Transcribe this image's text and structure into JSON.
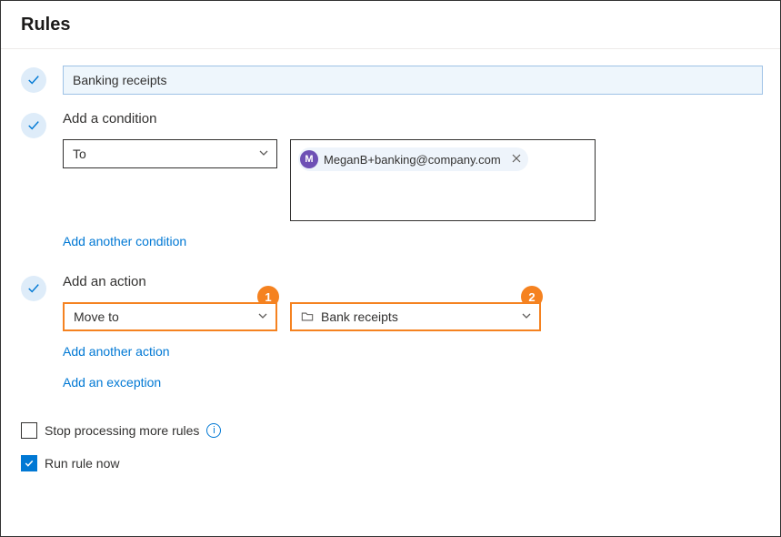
{
  "header": {
    "title": "Rules"
  },
  "rule": {
    "name": "Banking receipts"
  },
  "condition": {
    "label": "Add a condition",
    "type": "To",
    "recipient": {
      "initial": "M",
      "address": "MeganB+banking@company.com"
    },
    "addAnother": "Add another condition"
  },
  "action": {
    "label": "Add an action",
    "type": "Move to",
    "folder": "Bank receipts",
    "callouts": {
      "action": "1",
      "folder": "2"
    },
    "addAnotherAction": "Add another action",
    "addException": "Add an exception"
  },
  "footer": {
    "stopProcessing": {
      "label": "Stop processing more rules",
      "checked": false
    },
    "runNow": {
      "label": "Run rule now",
      "checked": true
    }
  }
}
